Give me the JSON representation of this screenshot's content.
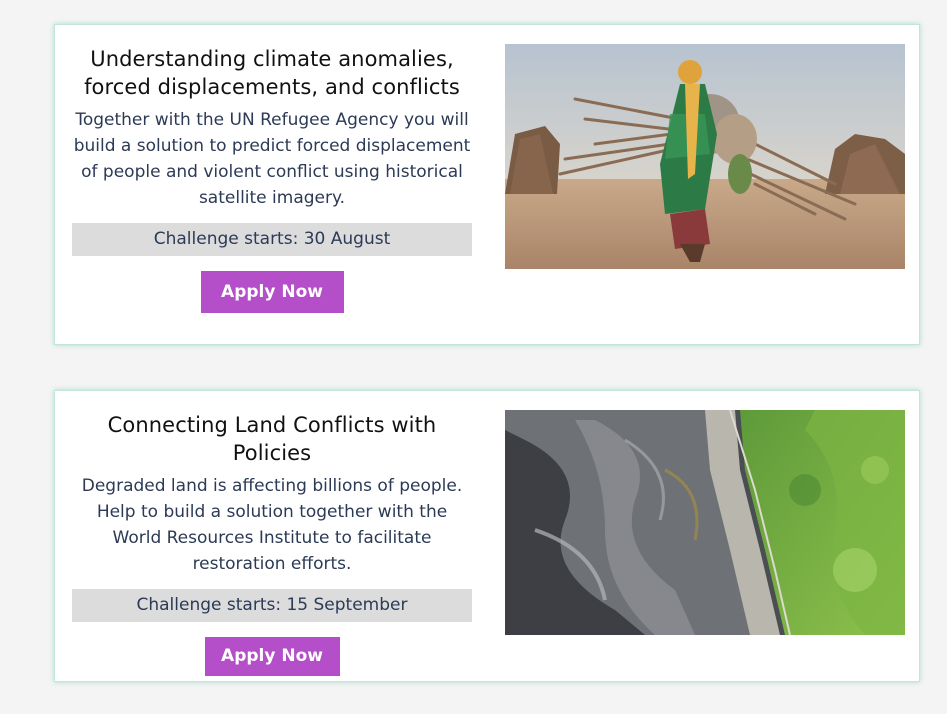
{
  "cards": [
    {
      "title": "Understanding climate anomalies, forced displacements, and conflicts",
      "description": "Together with the UN Refugee Agency you will build a solution to predict forced displacement of people and violent conflict using historical satellite imagery.",
      "date_label": "Challenge starts: 30 August",
      "button_label": "Apply Now",
      "image_subject": "woman-carrying-firewood-desert-photo"
    },
    {
      "title": "Connecting Land Conflicts with Policies",
      "description": "Degraded land is affecting billions of people. Help to build a solution together with the World Resources Institute to facilitate restoration efforts.",
      "date_label": "Challenge starts: 15 September",
      "button_label": "Apply Now",
      "image_subject": "aerial-degraded-land-forest-photo"
    }
  ],
  "colors": {
    "accent_button": "#b44fc9",
    "date_bar": "#dcdcdc",
    "card_border": "#bfe5dc",
    "body_text": "#2c3a56"
  }
}
